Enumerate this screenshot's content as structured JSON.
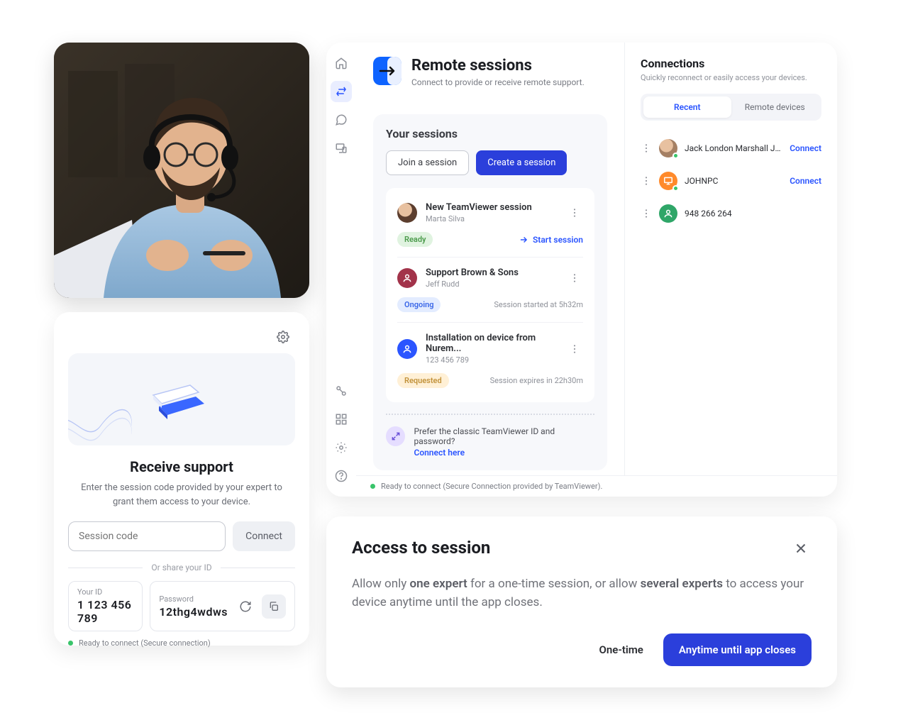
{
  "support_card": {
    "title": "Receive support",
    "subtitle": "Enter the session code provided by your expert to grant them access to your device.",
    "session_code_placeholder": "Session code",
    "connect_label": "Connect",
    "or_label": "Or share your ID",
    "id_label": "Your ID",
    "id_value": "1 123 456 789",
    "password_label": "Password",
    "password_value": "12thg4wdws",
    "footer_status": "Ready to connect (Secure connection)"
  },
  "app": {
    "header": {
      "title": "Remote sessions",
      "subtitle": "Connect to provide or receive remote support."
    },
    "sessions": {
      "panel_title": "Your sessions",
      "join_label": "Join a session",
      "create_label": "Create a session",
      "items": [
        {
          "title": "New TeamViewer session",
          "sub": "Marta Silva",
          "badge": "Ready",
          "badge_class": "ready",
          "right_label": "Start session",
          "right_type": "link"
        },
        {
          "title": "Support Brown & Sons",
          "sub": "Jeff Rudd",
          "badge": "Ongoing",
          "badge_class": "ongoing",
          "right_label": "Session started at 5h32m",
          "right_type": "info"
        },
        {
          "title": "Installation on device from Nurem...",
          "sub": "123 456 789",
          "badge": "Requested",
          "badge_class": "requested",
          "right_label": "Session expires in 22h30m",
          "right_type": "info"
        }
      ],
      "classic_question": "Prefer the classic TeamViewer ID and password?",
      "classic_link": "Connect here"
    },
    "footer_status": "Ready to connect (Secure Connection provided by TeamViewer).",
    "connections": {
      "title": "Connections",
      "subtitle": "Quickly reconnect or easily access your devices.",
      "tab_recent": "Recent",
      "tab_remote": "Remote devices",
      "items": [
        {
          "name": "Jack London Marshall Juni...",
          "avatar": "person",
          "presence": true,
          "action": "Connect"
        },
        {
          "name": "JOHNPC",
          "avatar": "pc",
          "presence": true,
          "action": "Connect"
        },
        {
          "name": "948 266 264",
          "avatar": "phone",
          "presence": false,
          "action": ""
        }
      ]
    }
  },
  "modal": {
    "title": "Access to session",
    "body_prefix": "Allow only ",
    "body_bold1": "one expert",
    "body_mid": " for a one-time session, or allow ",
    "body_bold2": "several experts",
    "body_suffix": " to access your device anytime until the app closes.",
    "one_time_label": "One-time",
    "anytime_label": "Anytime until app closes"
  }
}
